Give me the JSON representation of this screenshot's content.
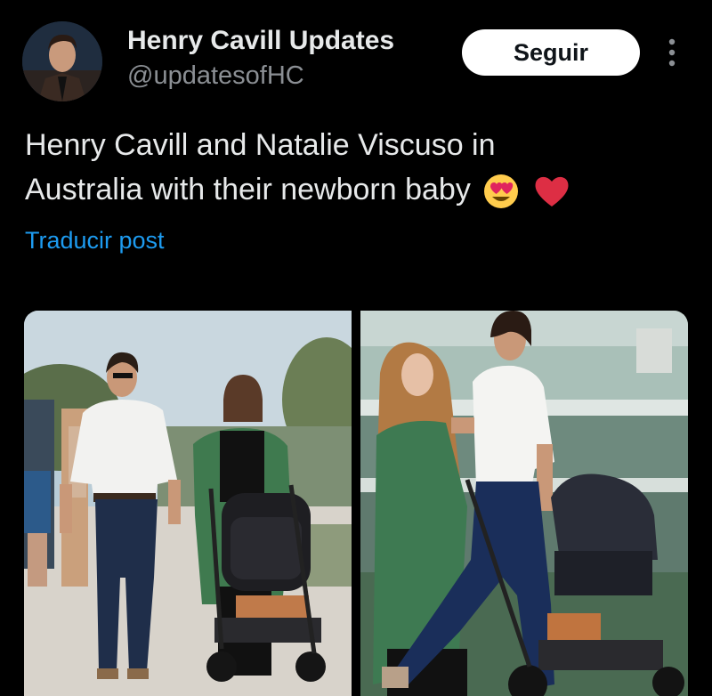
{
  "account": {
    "display_name": "Henry Cavill Updates",
    "handle": "@updatesofHC",
    "follow_label": "Seguir"
  },
  "post": {
    "text_line1": "Henry Cavill and Natalie Viscuso in",
    "text_line2": "Australia with their newborn baby",
    "emojis": [
      "smiling-face-with-heart-eyes",
      "red-heart"
    ],
    "translate_label": "Traducir post"
  },
  "icons": {
    "more": "more-vertical-icon"
  },
  "colors": {
    "background": "#000000",
    "text": "#e7e9ea",
    "secondary_text": "#8b8f94",
    "link": "#1d9bf0",
    "follow_button": "#ffffff"
  }
}
